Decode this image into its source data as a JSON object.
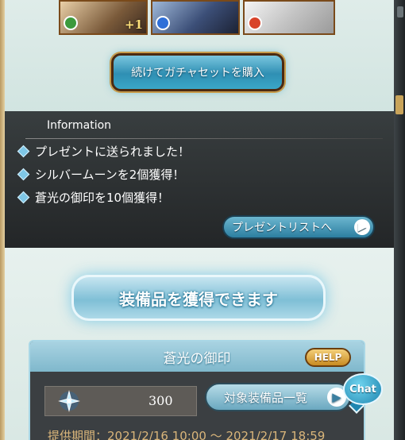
{
  "cards": [
    {
      "element": "wind-icon",
      "badge": "+1"
    },
    {
      "element": "water-icon",
      "badge": ""
    },
    {
      "element": "fire-icon",
      "badge": ""
    }
  ],
  "gacha_button": {
    "label": "続けてガチャセットを購入"
  },
  "information": {
    "title": "Information",
    "items": [
      {
        "text": "プレゼントに送られました！"
      },
      {
        "text": "シルバームーンを2個獲得！"
      },
      {
        "text": "蒼光の御印を10個獲得！"
      }
    ],
    "present_button": "プレゼントリストへ"
  },
  "equip_banner": {
    "text": "装備品を獲得できます"
  },
  "seal_panel": {
    "title": "蒼光の御印",
    "help_label": "HELP",
    "count": "300",
    "target_button": "対象装備品一覧",
    "period": "提供期間：2021/2/16 10:00 〜 2021/2/17 18:59"
  },
  "chat": {
    "label": "Chat",
    "sub": "..."
  },
  "colors": {
    "accent": "#2f8fb3",
    "gold": "#c98b22",
    "panel": "#3b3f42"
  }
}
